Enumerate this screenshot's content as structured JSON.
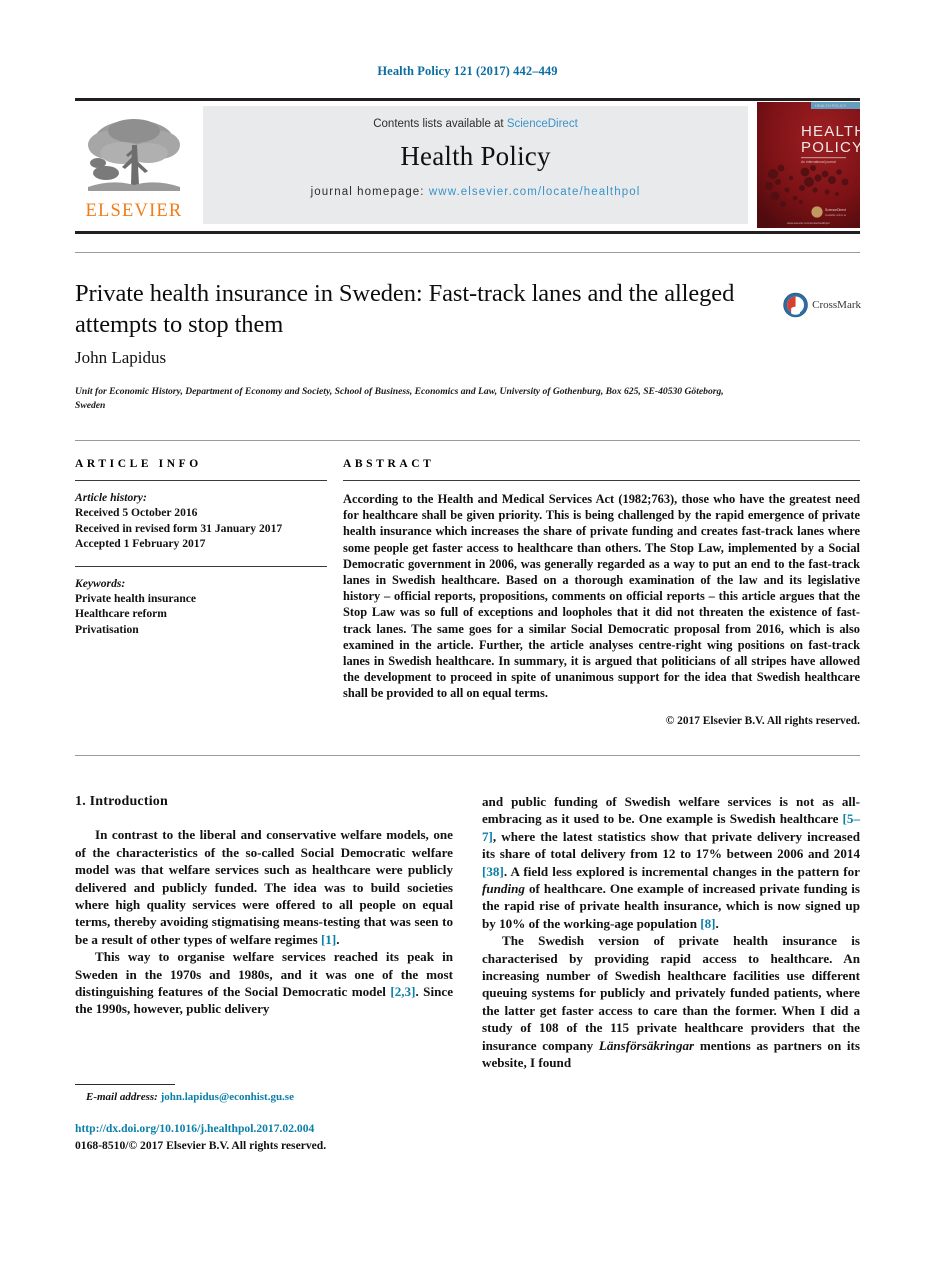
{
  "running_head": "Health Policy 121 (2017) 442–449",
  "masthead": {
    "contents_prefix": "Contents lists available at ",
    "sciencedirect": "ScienceDirect",
    "journal_name": "Health Policy",
    "homepage_prefix": "journal homepage: ",
    "homepage_url": "www.elsevier.com/locate/healthpol",
    "publisher_wordmark": "ELSEVIER",
    "cover_title_line1": "HEALTH",
    "cover_title_line2": "POLICY",
    "colors": {
      "link": "#3a93c8",
      "running_head": "#0a6ea1",
      "elsevier_orange": "#f07c1a",
      "cover_red": "#7d1216",
      "panel_grey": "#e9eaec"
    }
  },
  "article": {
    "title": "Private health insurance in Sweden: Fast-track lanes and the alleged attempts to stop them",
    "author": "John Lapidus",
    "affiliation": "Unit for Economic History, Department of Economy and Society, School of Business, Economics and Law, University of Gothenburg, Box 625, SE-40530 Göteborg, Sweden",
    "crossmark_label": "CrossMark"
  },
  "info": {
    "heading": "ARTICLE INFO",
    "history_label": "Article history:",
    "history": [
      "Received 5 October 2016",
      "Received in revised form 31 January 2017",
      "Accepted 1 February 2017"
    ],
    "keywords_label": "Keywords:",
    "keywords": [
      "Private health insurance",
      "Healthcare reform",
      "Privatisation"
    ]
  },
  "abstract": {
    "heading": "ABSTRACT",
    "text": "According to the Health and Medical Services Act (1982;763), those who have the greatest need for healthcare shall be given priority. This is being challenged by the rapid emergence of private health insurance which increases the share of private funding and creates fast-track lanes where some people get faster access to healthcare than others. The Stop Law, implemented by a Social Democratic government in 2006, was generally regarded as a way to put an end to the fast-track lanes in Swedish healthcare. Based on a thorough examination of the law and its legislative history – official reports, propositions, comments on official reports – this article argues that the Stop Law was so full of exceptions and loopholes that it did not threaten the existence of fast-track lanes. The same goes for a similar Social Democratic proposal from 2016, which is also examined in the article. Further, the article analyses centre-right wing positions on fast-track lanes in Swedish healthcare. In summary, it is argued that politicians of all stripes have allowed the development to proceed in spite of unanimous support for the idea that Swedish healthcare shall be provided to all on equal terms.",
    "copyright": "© 2017 Elsevier B.V. All rights reserved."
  },
  "body": {
    "section_title": "1. Introduction",
    "left_paragraph_1": "In contrast to the liberal and conservative welfare models, one of the characteristics of the so-called Social Democratic welfare model was that welfare services such as healthcare were publicly delivered and publicly funded. The idea was to build societies where high quality services were offered to all people on equal terms, thereby avoiding stigmatising means-testing that was seen to be a result of other types of welfare regimes [1].",
    "left_paragraph_2": "This way to organise welfare services reached its peak in Sweden in the 1970s and 1980s, and it was one of the most distinguishing features of the Social Democratic model [2,3]. Since the 1990s, however, public delivery",
    "right_paragraph_1": "and public funding of Swedish welfare services is not as all-embracing as it used to be. One example is Swedish healthcare [5–7], where the latest statistics show that private delivery increased its share of total delivery from 12 to 17% between 2006 and 2014 [38]. A field less explored is incremental changes in the pattern for funding of healthcare. One example of increased private funding is the rapid rise of private health insurance, which is now signed up by 10% of the working-age population [8].",
    "right_paragraph_2": "The Swedish version of private health insurance is characterised by providing rapid access to healthcare. An increasing number of Swedish healthcare facilities use different queuing systems for publicly and privately funded patients, where the latter get faster access to care than the former. When I did a study of 108 of the 115 private healthcare providers that the insurance company Länsförsäkringar mentions as partners on its website, I found"
  },
  "footer": {
    "email_label": "E-mail address:",
    "email": "john.lapidus@econhist.gu.se",
    "doi": "http://dx.doi.org/10.1016/j.healthpol.2017.02.004",
    "issn_line": "0168-8510/© 2017 Elsevier B.V. All rights reserved."
  }
}
